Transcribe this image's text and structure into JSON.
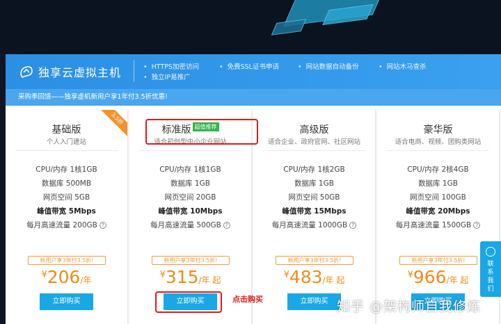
{
  "header": {
    "title": "独享云虚拟主机",
    "features": [
      "HTTPS加密访问",
      "免费SSL证书申请",
      "网站数据自动备份",
      "网站木马查杀",
      "独立IP易推广"
    ]
  },
  "notice": "采购季回馈——独享虚机新用户享1年付3.5折优惠!",
  "cards": [
    {
      "name": "基础版",
      "subtitle": "个人入门建站",
      "ribbon": "3.5折",
      "specs": [
        "CPU/内存 1核1GB",
        "数据库 500MB",
        "网页空间 5GB",
        "峰值带宽 5Mbps",
        "每月高速流量 200GB"
      ],
      "promo": "新用户享3年付3.5折!",
      "price_symbol": "¥",
      "price": "206",
      "unit": "/年",
      "buy": "立即购买"
    },
    {
      "name": "标准版",
      "badge": "超值推荐",
      "subtitle": "适合初创型中小企业网站",
      "specs": [
        "CPU/内存 1核1GB",
        "数据库 1GB",
        "网页空间 20GB",
        "峰值带宽 10Mbps",
        "每月高速流量 500GB"
      ],
      "promo": "新用户享3年付3.5折!",
      "price_symbol": "¥",
      "price": "315",
      "unit": "/年 起",
      "buy": "立即购买"
    },
    {
      "name": "高级版",
      "subtitle": "适合企业、政府官网、社区网站",
      "specs": [
        "CPU/内存 1核2GB",
        "数据库 1GB",
        "网页空间 50GB",
        "峰值带宽 15Mbps",
        "每月高速流量 1000GB"
      ],
      "promo": "新用户享3年付3.5折!",
      "price_symbol": "¥",
      "price": "483",
      "unit": "/年 起",
      "buy": "立即购买"
    },
    {
      "name": "豪华版",
      "subtitle": "适合电商、视频、团购类网站",
      "specs": [
        "CPU/内存 2核4GB",
        "数据库 1GB",
        "网页空间 100GB",
        "峰值带宽 20Mbps",
        "每月高速流量 1500GB"
      ],
      "promo": "新用户享3年付3.5折!",
      "price_symbol": "¥",
      "price": "966",
      "unit": "/年 起",
      "buy": "立即购买"
    }
  ],
  "annotation": "点击购买",
  "side_widget": "联系我们",
  "watermark": "知乎 @架构师自我修炼",
  "colors": {
    "brand_blue": "#2b8fe4",
    "price_orange": "#f08b1a",
    "buy_button": "#19a7e6",
    "highlight_red": "#e0191b",
    "badge_green": "#34b34a"
  },
  "icons": {
    "logo": "cloud-host-icon",
    "help": "question-circle-icon",
    "side": "chat-bubble-icon"
  }
}
